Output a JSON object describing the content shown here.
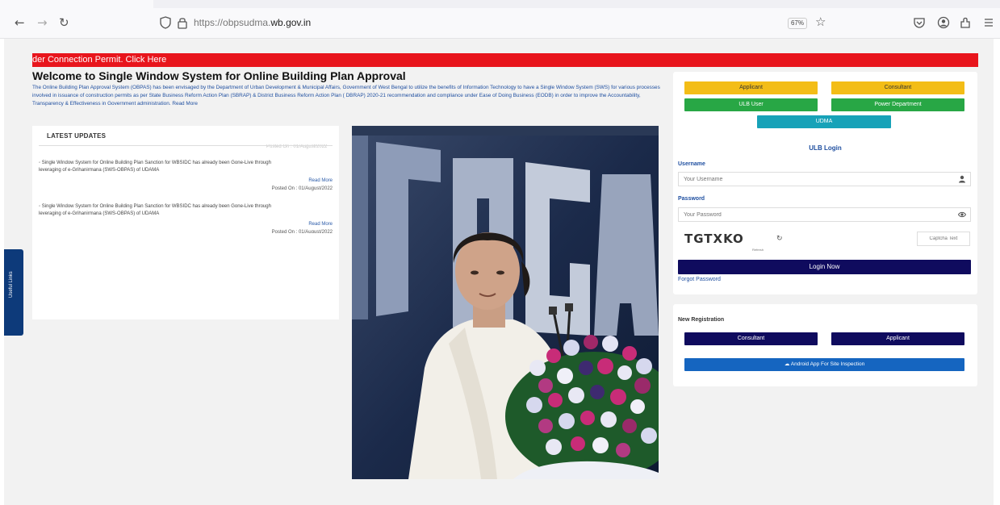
{
  "browser": {
    "url_prefix": "https://obpsudma.",
    "url_domain": "wb.gov.in",
    "zoom": "67%",
    "icons": [
      "back-arrow-icon",
      "forward-arrow-icon",
      "reload-icon",
      "shield-icon",
      "lock-icon",
      "star-icon",
      "pocket-icon",
      "account-icon",
      "extensions-icon",
      "menu-icon"
    ]
  },
  "ticker": {
    "text": "der Connection Permit. Click Here"
  },
  "welcome": {
    "title": "Welcome to Single Window System for Online Building Plan Approval",
    "intro": "The Online Building Plan Approval System (OBPAS) has been envisaged by the Department of Urban Development & Municipal Affairs, Government of West Bengal to utilize the benefits of Information Technology to have a Single Window System (SWS) for various processes involved in issuance of construction permits as per State Business Reform Action Plan (SBRAP) & District Business Reform Action Plan ( DBRAP) 2020-21 recommendation and compliance under Ease of Doing Business (EODB) in order to improve the Accountability, Transparency & Effectiveness in Government administration. Read More"
  },
  "updates": {
    "header": "LATEST UPDATES",
    "faded_top": "Posted On : 01/August/2022",
    "items": [
      {
        "text": "Single Window System for Online Building Plan Sanction for WBSIDC has already been Gone-Live through leveraging of e-Grihanirmana (SWS-OBPAS) of UDAMA",
        "read_more": "Read More",
        "posted": "Posted On : 01/August/2022"
      },
      {
        "text": "Single Window System for Online Building Plan Sanction for WBSIDC has already been Gone-Live through leveraging of e-Grihanirmana (SWS-OBPAS) of UDAMA",
        "read_more": "Read More",
        "posted": "Posted On : 01/August/2022"
      }
    ]
  },
  "login": {
    "roles": {
      "applicant": "Applicant",
      "consultant": "Consultant",
      "ulb_user": "ULB User",
      "power_department": "Power Department",
      "udma": "UDMA"
    },
    "title": "ULB Login",
    "username_label": "Username",
    "username_placeholder": "Your Username",
    "password_label": "Password",
    "password_placeholder": "Your Password",
    "captcha_text": "TGTXKO",
    "captcha_sub": "Refresh",
    "captcha_placeholder": "Captcha Text",
    "login_button": "Login Now",
    "forgot": "Forgot Password"
  },
  "registration": {
    "title": "New Registration",
    "consultant": "Consultant",
    "applicant": "Applicant",
    "android_app": "Android App For Site Inspection"
  },
  "side_tab": {
    "label": "Useful Links"
  },
  "colors": {
    "ticker": "#e8151c",
    "applicant": "#f3bd17",
    "ulb_user": "#28a745",
    "udma": "#17a2b8",
    "login": "#0f0b5e",
    "android": "#1565c0",
    "link_blue": "#1f4fa0"
  }
}
